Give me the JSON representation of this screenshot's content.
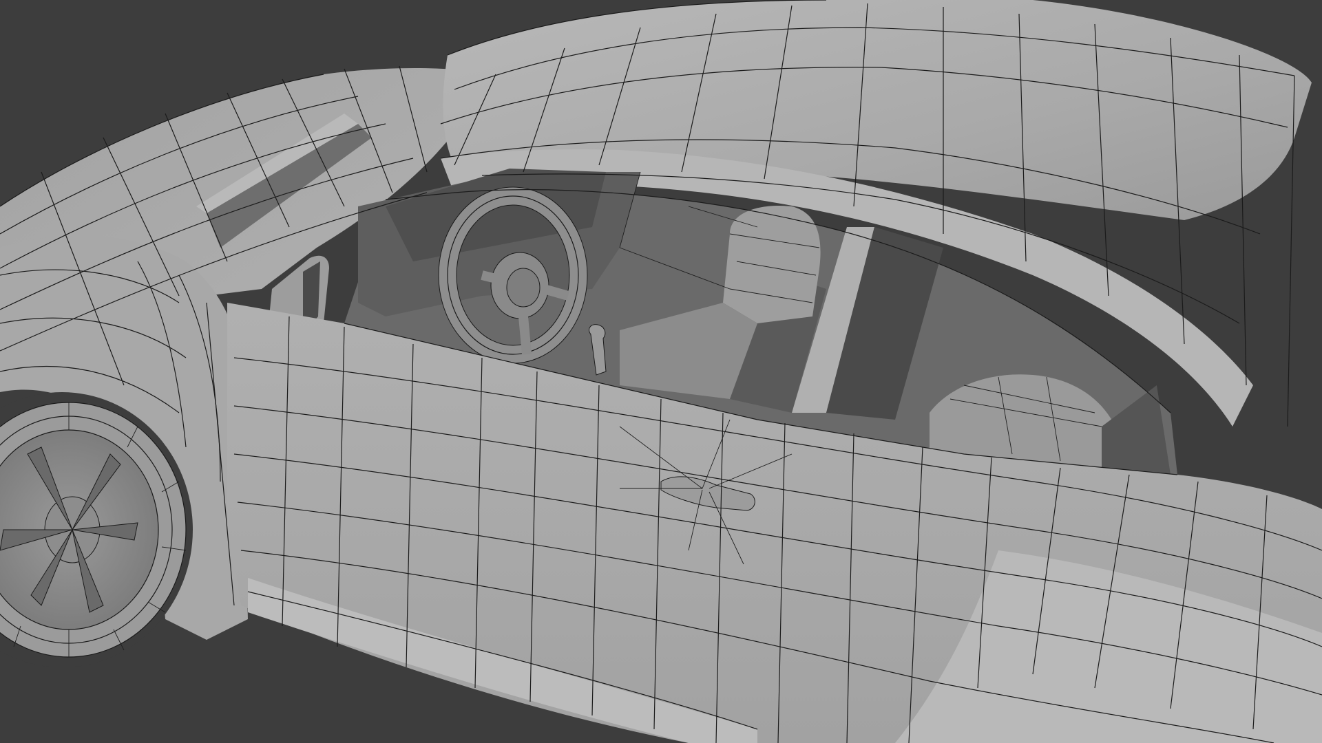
{
  "scene": {
    "background_color": "#3d3d3d",
    "body_color": "#a6a6a6",
    "body_light_color": "#b3b3b3",
    "body_dark_color": "#8a8a8a",
    "interior_dark_color": "#555555",
    "interior_mid_color": "#7a7a7a",
    "wire_color": "#1b1b1b"
  }
}
